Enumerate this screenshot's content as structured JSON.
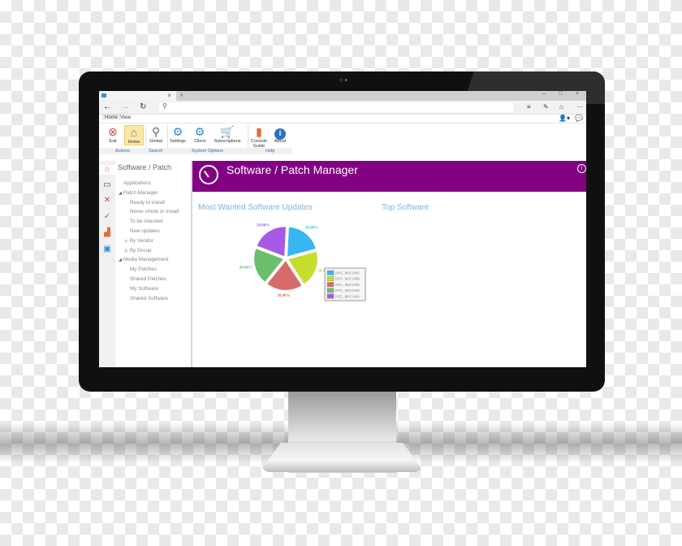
{
  "browser": {
    "tab_close": "×",
    "new_tab": "+",
    "window_controls": {
      "minimize": "–",
      "maximize": "□",
      "close": "×"
    },
    "nav": {
      "back": "←",
      "forward": "→",
      "refresh": "↻"
    },
    "search_glyph": "⚲",
    "toolbar_icons": [
      "≡",
      "✎",
      "⌂",
      "···"
    ]
  },
  "menu": {
    "items": [
      "Home",
      "View"
    ],
    "active": "Home"
  },
  "ribbon": {
    "buttons": [
      {
        "label": "Exit",
        "icon": "✖",
        "color": "#d9453b"
      },
      {
        "label": "Home",
        "icon": "⌂",
        "color": "#7d7d7d"
      },
      {
        "label": "Global",
        "icon": "🔍",
        "color": "#666666"
      },
      {
        "label": "Settings",
        "icon": "⚙",
        "color": "#2d86d1"
      },
      {
        "label": "Client",
        "icon": "⚙",
        "color": "#2d86d1"
      },
      {
        "label": "Subscriptions",
        "icon": "🛒",
        "color": "#2d86d1"
      },
      {
        "label": "Console Guide",
        "icon": "▮",
        "color": "#e06a3a"
      },
      {
        "label": "About",
        "icon": "i",
        "color": "#2d6fc2"
      }
    ],
    "groups": [
      "Actions",
      "Search",
      "System Options",
      "Help"
    ]
  },
  "sidebar": {
    "icons": [
      "home-icon",
      "monitor-icon",
      "tools-icon",
      "checklist-icon",
      "chart-icon",
      "window-icon"
    ],
    "title": "Software / Patch",
    "tree": [
      {
        "label": "Applications",
        "level": 0
      },
      {
        "label": "Patch Manager",
        "level": 0,
        "expanded": true
      },
      {
        "label": "Ready to install",
        "level": 1
      },
      {
        "label": "Never check or install",
        "level": 1
      },
      {
        "label": "To be checked",
        "level": 1
      },
      {
        "label": "New updates",
        "level": 1
      },
      {
        "label": "By Vendor",
        "level": 1,
        "collapsed": true
      },
      {
        "label": "By Group",
        "level": 1,
        "collapsed": true
      },
      {
        "label": "Media Management",
        "level": 0,
        "expanded": true
      },
      {
        "label": "My Patches",
        "level": 1
      },
      {
        "label": "Shared Patches",
        "level": 1
      },
      {
        "label": "My Software",
        "level": 1
      },
      {
        "label": "Shared Software",
        "level": 1
      }
    ]
  },
  "main": {
    "title": "Software / Patch Manager",
    "info_glyph": "i",
    "brand_color": "#820082",
    "sections": [
      "Most Wanted Software Updates",
      "Top Software"
    ]
  },
  "chart_data": {
    "type": "pie",
    "title": "Most Wanted Software Updates",
    "categories": [
      "INTL_MS15-085",
      "INTL_MS15-088",
      "INTL_MS15-089",
      "INTL_MS15-090",
      "INTL_MS15-093"
    ],
    "values": [
      20,
      20,
      20,
      20,
      20
    ],
    "labels": [
      "20.00%",
      "20.00%",
      "20.00%",
      "20.00%",
      "20.00%"
    ],
    "colors": [
      "#38b6f2",
      "#c8dc2c",
      "#d86a6a",
      "#6cbe6c",
      "#a65ae6"
    ],
    "legend": "right"
  }
}
